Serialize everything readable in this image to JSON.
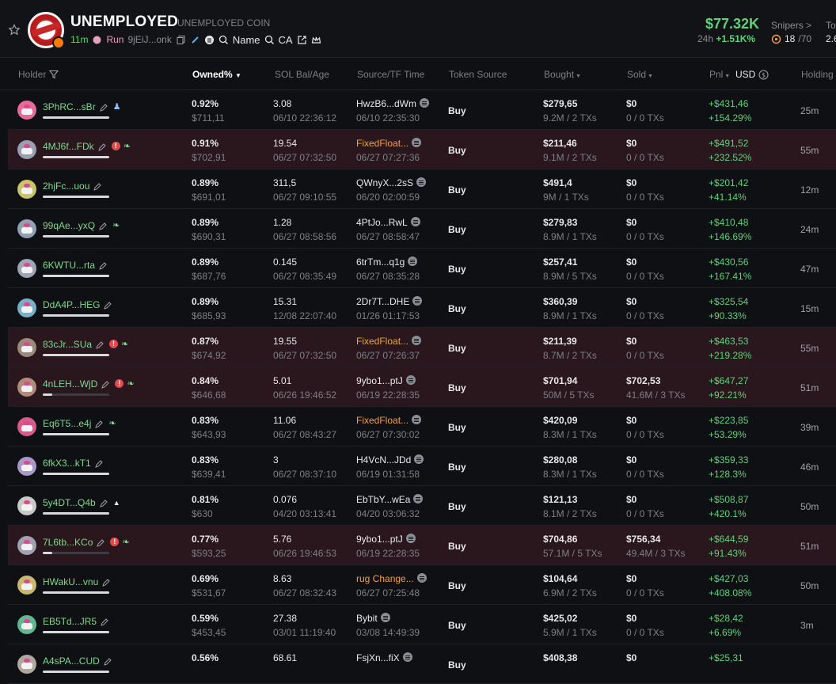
{
  "token": {
    "name": "UNEMPLOYED",
    "full_name": "UNEMPLOYED COIN",
    "age": "11m",
    "run_label": "Run",
    "address_short": "9jEiJ...onk",
    "name_search_label": "Name",
    "ca_search_label": "CA",
    "price": "$77.32K",
    "change_label": "24h",
    "change_value": "+1.51K%",
    "snipers_label": "Snipers >",
    "snipers_count": "18",
    "snipers_total": "/70",
    "top_label_cut": "To",
    "top_value_cut": "2.6"
  },
  "columns": {
    "holder": "Holder",
    "owned": "Owned%",
    "sol": "SOL Bal/Age",
    "source_tf": "Source/TF Time",
    "token_source": "Token Source",
    "bought": "Bought",
    "sold": "Sold",
    "pnl": "Pnl",
    "usd": "USD",
    "holding": "Holding I"
  },
  "rows": [
    {
      "holder": "3PhRC...sBr",
      "tags": [
        "ghost"
      ],
      "bar": "full",
      "owned": "0.92%",
      "owned_usd": "$711,11",
      "sol": "3.08",
      "sol_age": "06/10 22:36:12",
      "source": "HwzB6...dWm",
      "source_color": "white",
      "tf": "06/10 22:35:30",
      "token_source": "Buy",
      "bought": "$279,65",
      "bought_sub": "9.2M / 2 TXs",
      "sold": "$0",
      "sold_sub": "0 / 0 TXs",
      "pnl": "+$431,46",
      "pnl_pct": "+154.29%",
      "holding": "25m",
      "highlight": false
    },
    {
      "holder": "4MJ6f...FDk",
      "tags": [
        "warn",
        "leaf"
      ],
      "bar": "full",
      "owned": "0.91%",
      "owned_usd": "$702,91",
      "sol": "19.54",
      "sol_age": "06/27 07:32:50",
      "source": "FixedFloat...",
      "source_color": "orange",
      "tf": "06/27 07:27:36",
      "token_source": "Buy",
      "bought": "$211,46",
      "bought_sub": "9.1M / 2 TXs",
      "sold": "$0",
      "sold_sub": "0 / 0 TXs",
      "pnl": "+$491,52",
      "pnl_pct": "+232.52%",
      "holding": "55m",
      "highlight": true
    },
    {
      "holder": "2hjFc...uou",
      "tags": [],
      "bar": "full",
      "owned": "0.89%",
      "owned_usd": "$691,01",
      "sol": "311,5",
      "sol_age": "06/27 09:10:55",
      "source": "QWnyX...2sS",
      "source_color": "white",
      "tf": "06/20 02:00:59",
      "token_source": "Buy",
      "bought": "$491,4",
      "bought_sub": "9M / 1 TXs",
      "sold": "$0",
      "sold_sub": "0 / 0 TXs",
      "pnl": "+$201,42",
      "pnl_pct": "+41.14%",
      "holding": "12m",
      "highlight": false
    },
    {
      "holder": "99qAe...yxQ",
      "tags": [
        "leaf"
      ],
      "bar": "full",
      "owned": "0.89%",
      "owned_usd": "$690,31",
      "sol": "1.28",
      "sol_age": "06/27 08:58:56",
      "source": "4PtJo...RwL",
      "source_color": "white",
      "tf": "06/27 08:58:47",
      "token_source": "Buy",
      "bought": "$279,83",
      "bought_sub": "8.9M / 1 TXs",
      "sold": "$0",
      "sold_sub": "0 / 0 TXs",
      "pnl": "+$410,48",
      "pnl_pct": "+146.69%",
      "holding": "24m",
      "highlight": false
    },
    {
      "holder": "6KWTU...rta",
      "tags": [],
      "bar": "full",
      "owned": "0.89%",
      "owned_usd": "$687,76",
      "sol": "0.145",
      "sol_age": "06/27 08:35:49",
      "source": "6trTm...q1g",
      "source_color": "white",
      "tf": "06/27 08:35:28",
      "token_source": "Buy",
      "bought": "$257,41",
      "bought_sub": "8.9M / 5 TXs",
      "sold": "$0",
      "sold_sub": "0 / 0 TXs",
      "pnl": "+$430,56",
      "pnl_pct": "+167.41%",
      "holding": "47m",
      "highlight": false
    },
    {
      "holder": "DdA4P...HEG",
      "tags": [],
      "bar": "full",
      "owned": "0.89%",
      "owned_usd": "$685,93",
      "sol": "15.31",
      "sol_age": "12/08 22:07:40",
      "source": "2Dr7T...DHE",
      "source_color": "white",
      "tf": "01/26 01:17:53",
      "token_source": "Buy",
      "bought": "$360,39",
      "bought_sub": "8.9M / 1 TXs",
      "sold": "$0",
      "sold_sub": "0 / 0 TXs",
      "pnl": "+$325,54",
      "pnl_pct": "+90.33%",
      "holding": "15m",
      "highlight": false
    },
    {
      "holder": "83cJr...SUa",
      "tags": [
        "warn",
        "leaf"
      ],
      "bar": "full",
      "owned": "0.87%",
      "owned_usd": "$674,92",
      "sol": "19.55",
      "sol_age": "06/27 07:32:50",
      "source": "FixedFloat...",
      "source_color": "orange",
      "tf": "06/27 07:26:37",
      "token_source": "Buy",
      "bought": "$211,39",
      "bought_sub": "8.7M / 2 TXs",
      "sold": "$0",
      "sold_sub": "0 / 0 TXs",
      "pnl": "+$463,53",
      "pnl_pct": "+219.28%",
      "holding": "55m",
      "highlight": true
    },
    {
      "holder": "4nLEH...WjD",
      "tags": [
        "warn",
        "leaf"
      ],
      "bar": "partial",
      "owned": "0.84%",
      "owned_usd": "$646,68",
      "sol": "5.01",
      "sol_age": "06/26 19:46:52",
      "source": "9ybo1...ptJ",
      "source_color": "white",
      "tf": "06/19 22:28:35",
      "token_source": "Buy",
      "bought": "$701,94",
      "bought_sub": "50M / 5 TXs",
      "sold": "$702,53",
      "sold_sub": "41.6M / 3 TXs",
      "pnl": "+$647,27",
      "pnl_pct": "+92.21%",
      "holding": "51m",
      "highlight": true
    },
    {
      "holder": "Eq6T5...e4j",
      "tags": [
        "leaf"
      ],
      "bar": "full",
      "owned": "0.83%",
      "owned_usd": "$643,93",
      "sol": "11.06",
      "sol_age": "06/27 08:43:27",
      "source": "FixedFloat...",
      "source_color": "orange",
      "tf": "06/27 07:30:02",
      "token_source": "Buy",
      "bought": "$420,09",
      "bought_sub": "8.3M / 1 TXs",
      "sold": "$0",
      "sold_sub": "0 / 0 TXs",
      "pnl": "+$223,85",
      "pnl_pct": "+53.29%",
      "holding": "39m",
      "highlight": false
    },
    {
      "holder": "6fkX3...kT1",
      "tags": [],
      "bar": "full",
      "owned": "0.83%",
      "owned_usd": "$639,41",
      "sol": "3",
      "sol_age": "06/27 08:37:10",
      "source": "H4VcN...JDd",
      "source_color": "white",
      "tf": "06/19 01:31:58",
      "token_source": "Buy",
      "bought": "$280,08",
      "bought_sub": "8.3M / 1 TXs",
      "sold": "$0",
      "sold_sub": "0 / 0 TXs",
      "pnl": "+$359,33",
      "pnl_pct": "+128.3%",
      "holding": "46m",
      "highlight": false
    },
    {
      "holder": "5y4DT...Q4b",
      "tags": [
        "tri"
      ],
      "bar": "full",
      "owned": "0.81%",
      "owned_usd": "$630",
      "sol": "0.076",
      "sol_age": "04/20 03:13:41",
      "source": "EbTbY...wEa",
      "source_color": "white",
      "tf": "04/20 03:06:32",
      "token_source": "Buy",
      "bought": "$121,13",
      "bought_sub": "8.1M / 2 TXs",
      "sold": "$0",
      "sold_sub": "0 / 0 TXs",
      "pnl": "+$508,87",
      "pnl_pct": "+420.1%",
      "holding": "50m",
      "highlight": false
    },
    {
      "holder": "7L6tb...KCo",
      "tags": [
        "warn",
        "leaf"
      ],
      "bar": "partial",
      "owned": "0.77%",
      "owned_usd": "$593,25",
      "sol": "5.76",
      "sol_age": "06/26 19:46:53",
      "source": "9ybo1...ptJ",
      "source_color": "white",
      "tf": "06/19 22:28:35",
      "token_source": "Buy",
      "bought": "$704,86",
      "bought_sub": "57.1M / 5 TXs",
      "sold": "$756,34",
      "sold_sub": "49.4M / 3 TXs",
      "pnl": "+$644,59",
      "pnl_pct": "+91.43%",
      "holding": "51m",
      "highlight": true
    },
    {
      "holder": "HWakU...vnu",
      "tags": [],
      "bar": "full",
      "owned": "0.69%",
      "owned_usd": "$531,67",
      "sol": "8.63",
      "sol_age": "06/27 08:32:43",
      "source": "rug Change...",
      "source_color": "orange",
      "tf": "06/27 07:25:48",
      "token_source": "Buy",
      "bought": "$104,64",
      "bought_sub": "6.9M / 2 TXs",
      "sold": "$0",
      "sold_sub": "0 / 0 TXs",
      "pnl": "+$427,03",
      "pnl_pct": "+408.08%",
      "holding": "50m",
      "highlight": false
    },
    {
      "holder": "EB5Td...JR5",
      "tags": [],
      "bar": "full",
      "owned": "0.59%",
      "owned_usd": "$453,45",
      "sol": "27.38",
      "sol_age": "03/01 11:19:40",
      "source": "Bybit",
      "source_color": "white",
      "tf": "03/08 14:49:39",
      "token_source": "Buy",
      "bought": "$425,02",
      "bought_sub": "5.9M / 1 TXs",
      "sold": "$0",
      "sold_sub": "0 / 0 TXs",
      "pnl": "+$28,42",
      "pnl_pct": "+6.69%",
      "holding": "3m",
      "highlight": false
    },
    {
      "holder": "A4sPA...CUD",
      "tags": [],
      "bar": "full",
      "owned": "0.56%",
      "owned_usd": "",
      "sol": "68.61",
      "sol_age": "",
      "source": "FsjXn...fiX",
      "source_color": "white",
      "tf": "",
      "token_source": "Buy",
      "bought": "$408,38",
      "bought_sub": "",
      "sold": "$0",
      "sold_sub": "",
      "pnl": "+$25,31",
      "pnl_pct": "",
      "holding": "",
      "highlight": false
    }
  ],
  "colors": {
    "green": "#5fd17a",
    "orange": "#f0a04b",
    "highlight_row": "#2a171d",
    "warn": "#e5484d"
  }
}
